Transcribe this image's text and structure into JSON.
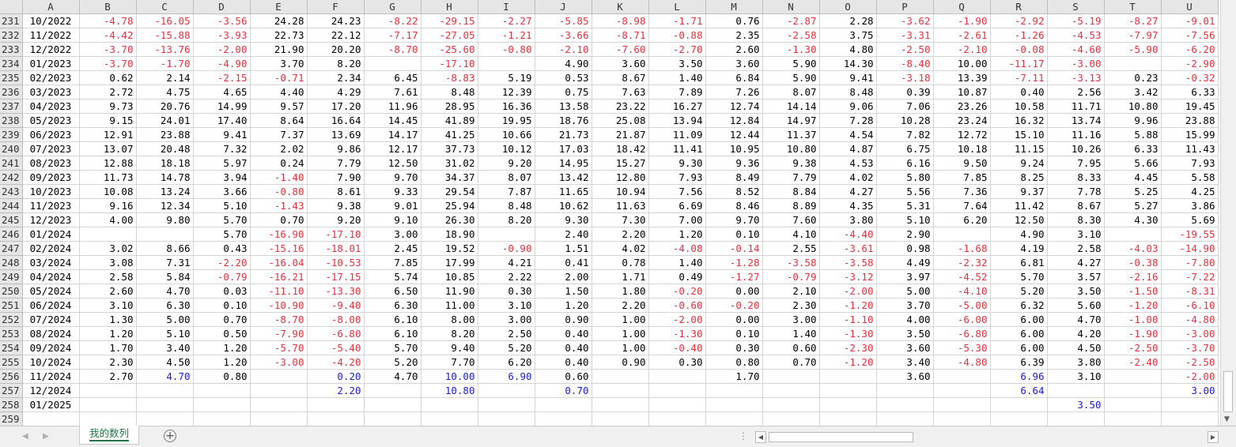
{
  "columns": [
    "A",
    "B",
    "C",
    "D",
    "E",
    "F",
    "G",
    "H",
    "I",
    "J",
    "K",
    "L",
    "M",
    "N",
    "O",
    "P",
    "Q",
    "R",
    "S",
    "T",
    "U"
  ],
  "rows": [
    {
      "n": "231",
      "cells": [
        "10/2022",
        "-4.78",
        "-16.05",
        "-3.56",
        "24.28",
        "24.23",
        "-8.22",
        "-29.15",
        "-2.27",
        "-5.85",
        "-8.98",
        "-1.71",
        "0.76",
        "-2.87",
        "2.28",
        "-3.62",
        "-1.90",
        "-2.92",
        "-5.19",
        "-8.27",
        "-9.01"
      ]
    },
    {
      "n": "232",
      "cells": [
        "11/2022",
        "-4.42",
        "-15.88",
        "-3.93",
        "22.73",
        "22.12",
        "-7.17",
        "-27.05",
        "-1.21",
        "-3.66",
        "-8.71",
        "-0.88",
        "2.35",
        "-2.58",
        "3.75",
        "-3.31",
        "-2.61",
        "-1.26",
        "-4.53",
        "-7.97",
        "-7.56"
      ]
    },
    {
      "n": "233",
      "cells": [
        "12/2022",
        "-3.70",
        "-13.76",
        "-2.00",
        "21.90",
        "20.20",
        "-8.70",
        "-25.60",
        "-0.80",
        "-2.10",
        "-7.60",
        "-2.70",
        "2.60",
        "-1.30",
        "4.80",
        "-2.50",
        "-2.10",
        "-0.08",
        "-4.60",
        "-5.90",
        "-6.20"
      ]
    },
    {
      "n": "234",
      "cells": [
        "01/2023",
        "-3.70",
        "-1.70",
        "-4.90",
        "3.70",
        "8.20",
        "",
        "-17.10",
        "",
        "4.90",
        "3.60",
        "3.50",
        "3.60",
        "5.90",
        "14.30",
        "-8.40",
        "10.00",
        "-11.17",
        "-3.00",
        "",
        "-2.90"
      ]
    },
    {
      "n": "235",
      "cells": [
        "02/2023",
        "0.62",
        "2.14",
        "-2.15",
        "-0.71",
        "2.34",
        "6.45",
        "-8.83",
        "5.19",
        "0.53",
        "8.67",
        "1.40",
        "6.84",
        "5.90",
        "9.41",
        "-3.18",
        "13.39",
        "-7.11",
        "-3.13",
        "0.23",
        "-0.32"
      ]
    },
    {
      "n": "236",
      "cells": [
        "03/2023",
        "2.72",
        "4.75",
        "4.65",
        "4.40",
        "4.29",
        "7.61",
        "8.48",
        "12.39",
        "0.75",
        "7.63",
        "7.89",
        "7.26",
        "8.07",
        "8.48",
        "0.39",
        "10.87",
        "0.40",
        "2.56",
        "3.42",
        "6.33"
      ]
    },
    {
      "n": "237",
      "cells": [
        "04/2023",
        "9.73",
        "20.76",
        "14.99",
        "9.57",
        "17.20",
        "11.96",
        "28.95",
        "16.36",
        "13.58",
        "23.22",
        "16.27",
        "12.74",
        "14.14",
        "9.06",
        "7.06",
        "23.26",
        "10.58",
        "11.71",
        "10.80",
        "19.45"
      ]
    },
    {
      "n": "238",
      "cells": [
        "05/2023",
        "9.15",
        "24.01",
        "17.40",
        "8.64",
        "16.64",
        "14.45",
        "41.89",
        "19.95",
        "18.76",
        "25.08",
        "13.94",
        "12.84",
        "14.97",
        "7.28",
        "10.28",
        "23.24",
        "16.32",
        "13.74",
        "9.96",
        "23.88"
      ]
    },
    {
      "n": "239",
      "cells": [
        "06/2023",
        "12.91",
        "23.88",
        "9.41",
        "7.37",
        "13.69",
        "14.17",
        "41.25",
        "10.66",
        "21.73",
        "21.87",
        "11.09",
        "12.44",
        "11.37",
        "4.54",
        "7.82",
        "12.72",
        "15.10",
        "11.16",
        "5.88",
        "15.99"
      ]
    },
    {
      "n": "240",
      "cells": [
        "07/2023",
        "13.07",
        "20.48",
        "7.32",
        "2.02",
        "9.86",
        "12.17",
        "37.73",
        "10.12",
        "17.03",
        "18.42",
        "11.41",
        "10.95",
        "10.80",
        "4.87",
        "6.75",
        "10.18",
        "11.15",
        "10.26",
        "6.33",
        "11.43"
      ]
    },
    {
      "n": "241",
      "cells": [
        "08/2023",
        "12.88",
        "18.18",
        "5.97",
        "0.24",
        "7.79",
        "12.50",
        "31.02",
        "9.20",
        "14.95",
        "15.27",
        "9.30",
        "9.36",
        "9.38",
        "4.53",
        "6.16",
        "9.50",
        "9.24",
        "7.95",
        "5.66",
        "7.93"
      ]
    },
    {
      "n": "242",
      "cells": [
        "09/2023",
        "11.73",
        "14.78",
        "3.94",
        "-1.40",
        "7.90",
        "9.70",
        "34.37",
        "8.07",
        "13.42",
        "12.80",
        "7.93",
        "8.49",
        "7.79",
        "4.02",
        "5.80",
        "7.85",
        "8.25",
        "8.33",
        "4.45",
        "5.58"
      ]
    },
    {
      "n": "243",
      "cells": [
        "10/2023",
        "10.08",
        "13.24",
        "3.66",
        "-0.80",
        "8.61",
        "9.33",
        "29.54",
        "7.87",
        "11.65",
        "10.94",
        "7.56",
        "8.52",
        "8.84",
        "4.27",
        "5.56",
        "7.36",
        "9.37",
        "7.78",
        "5.25",
        "4.25"
      ]
    },
    {
      "n": "244",
      "cells": [
        "11/2023",
        "9.16",
        "12.34",
        "5.10",
        "-1.43",
        "9.38",
        "9.01",
        "25.94",
        "8.48",
        "10.62",
        "11.63",
        "6.69",
        "8.46",
        "8.89",
        "4.35",
        "5.31",
        "7.64",
        "11.42",
        "8.67",
        "5.27",
        "3.86"
      ]
    },
    {
      "n": "245",
      "cells": [
        "12/2023",
        "4.00",
        "9.80",
        "5.70",
        "0.70",
        "9.20",
        "9.10",
        "26.30",
        "8.20",
        "9.30",
        "7.30",
        "7.00",
        "9.70",
        "7.60",
        "3.80",
        "5.10",
        "6.20",
        "12.50",
        "8.30",
        "4.30",
        "5.69"
      ]
    },
    {
      "n": "246",
      "cells": [
        "01/2024",
        "",
        "",
        "5.70",
        "-16.90",
        "-17.10",
        "3.00",
        "18.90",
        "",
        "2.40",
        "2.20",
        "1.20",
        "0.10",
        "4.10",
        "-4.40",
        "2.90",
        "",
        "4.90",
        "3.10",
        "",
        "-19.55"
      ]
    },
    {
      "n": "247",
      "cells": [
        "02/2024",
        "3.02",
        "8.66",
        "0.43",
        "-15.16",
        "-18.01",
        "2.45",
        "19.52",
        "-0.90",
        "1.51",
        "4.02",
        "-4.08",
        "-0.14",
        "2.55",
        "-3.61",
        "0.98",
        "-1.68",
        "4.19",
        "2.58",
        "-4.03",
        "-14.90"
      ]
    },
    {
      "n": "248",
      "cells": [
        "03/2024",
        "3.08",
        "7.31",
        "-2.20",
        "-16.04",
        "-10.53",
        "7.85",
        "17.99",
        "4.21",
        "0.41",
        "0.78",
        "1.40",
        "-1.28",
        "-3.58",
        "-3.58",
        "4.49",
        "-2.32",
        "6.81",
        "4.27",
        "-0.38",
        "-7.80"
      ]
    },
    {
      "n": "249",
      "cells": [
        "04/2024",
        "2.58",
        "5.84",
        "-0.79",
        "-16.21",
        "-17.15",
        "5.74",
        "10.85",
        "2.22",
        "2.00",
        "1.71",
        "0.49",
        "-1.27",
        "-0.79",
        "-3.12",
        "3.97",
        "-4.52",
        "5.70",
        "3.57",
        "-2.16",
        "-7.22"
      ]
    },
    {
      "n": "250",
      "cells": [
        "05/2024",
        "2.60",
        "4.70",
        "0.03",
        "-11.10",
        "-13.30",
        "6.50",
        "11.90",
        "0.30",
        "1.50",
        "1.80",
        "-0.20",
        "0.00",
        "2.10",
        "-2.00",
        "5.00",
        "-4.10",
        "5.20",
        "3.50",
        "-1.50",
        "-8.31"
      ]
    },
    {
      "n": "251",
      "cells": [
        "06/2024",
        "3.10",
        "6.30",
        "0.10",
        "-10.90",
        "-9.40",
        "6.30",
        "11.00",
        "3.10",
        "1.20",
        "2.20",
        "-0.60",
        "-0.20",
        "2.30",
        "-1.20",
        "3.70",
        "-5.00",
        "6.32",
        "5.60",
        "-1.20",
        "-6.10"
      ]
    },
    {
      "n": "252",
      "cells": [
        "07/2024",
        "1.30",
        "5.00",
        "0.70",
        "-8.70",
        "-8.00",
        "6.10",
        "8.00",
        "3.00",
        "0.90",
        "1.00",
        "-2.00",
        "0.00",
        "3.00",
        "-1.10",
        "4.00",
        "-6.00",
        "6.00",
        "4.70",
        "-1.00",
        "-4.80"
      ]
    },
    {
      "n": "253",
      "cells": [
        "08/2024",
        "1.20",
        "5.10",
        "0.50",
        "-7.90",
        "-6.80",
        "6.10",
        "8.20",
        "2.50",
        "0.40",
        "1.00",
        "-1.30",
        "0.10",
        "1.40",
        "-1.30",
        "3.50",
        "-6.80",
        "6.00",
        "4.20",
        "-1.90",
        "-3.00"
      ]
    },
    {
      "n": "254",
      "cells": [
        "09/2024",
        "1.70",
        "3.40",
        "1.20",
        "-5.70",
        "-5.40",
        "5.70",
        "9.40",
        "5.20",
        "0.40",
        "1.00",
        "-0.40",
        "0.30",
        "0.60",
        "-2.30",
        "3.60",
        "-5.30",
        "6.00",
        "4.50",
        "-2.50",
        "-3.70"
      ]
    },
    {
      "n": "255",
      "cells": [
        "10/2024",
        "2.30",
        "4.50",
        "1.20",
        "-3.00",
        "-4.20",
        "5.20",
        "7.70",
        "6.20",
        "0.40",
        "0.90",
        "0.30",
        "0.80",
        "0.70",
        "-1.20",
        "3.40",
        "-4.80",
        "6.39",
        "3.80",
        "-2.40",
        "-2.50"
      ]
    },
    {
      "n": "256",
      "cells": [
        "11/2024",
        "2.70",
        "4.70",
        "0.80",
        "",
        "0.20",
        "4.70",
        "10.00",
        "6.90",
        "0.60",
        "",
        "",
        "1.70",
        "",
        "",
        "3.60",
        "",
        "6.96",
        "3.10",
        "",
        "-2.00"
      ]
    },
    {
      "n": "257",
      "cells": [
        "12/2024",
        "",
        "",
        "",
        "",
        "2.20",
        "",
        "10.80",
        "",
        "0.70",
        "",
        "",
        "",
        "",
        "",
        "",
        "",
        "6.64",
        "",
        "",
        "3.00"
      ]
    },
    {
      "n": "258",
      "cells": [
        "01/2025",
        "",
        "",
        "",
        "",
        "",
        "",
        "",
        "",
        "",
        "",
        "",
        "",
        "",
        "",
        "",
        "",
        "",
        "3.50",
        "",
        ""
      ]
    },
    {
      "n": "259",
      "cells": [
        "",
        "",
        "",
        "",
        "",
        "",
        "",
        "",
        "",
        "",
        "",
        "",
        "",
        "",
        "",
        "",
        "",
        "",
        "",
        "",
        ""
      ]
    }
  ],
  "blue_cells": [
    "256-C",
    "256-F",
    "256-H",
    "256-I",
    "256-R",
    "257-F",
    "257-H",
    "257-J",
    "257-R",
    "257-U",
    "258-S"
  ],
  "colors": {
    "negative": "#e8303a",
    "highlight_blue": "#1a1adf",
    "tab_green": "#217346"
  },
  "sheet_tab": {
    "label": "我的数列"
  },
  "controls": {
    "add_sheet_icon": "plus-circle-icon",
    "prev_icon": "triangle-left-icon",
    "next_icon": "triangle-right-icon"
  }
}
